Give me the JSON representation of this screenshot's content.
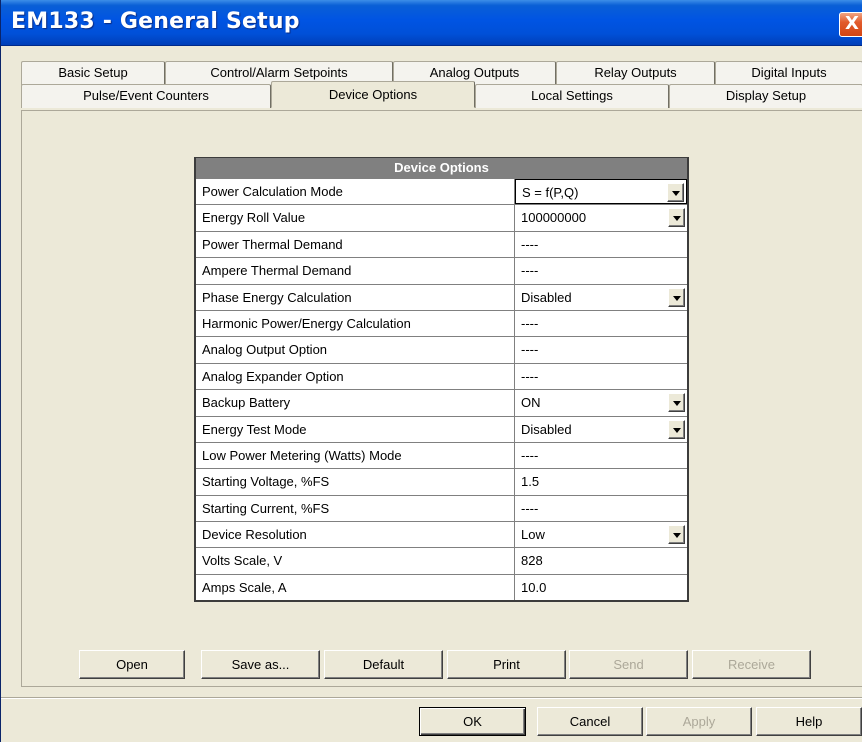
{
  "window": {
    "title": "EM133 - General Setup",
    "close_glyph": "X"
  },
  "tabs": {
    "back_row": [
      "Basic Setup",
      "Control/Alarm Setpoints",
      "Analog Outputs",
      "Relay Outputs",
      "Digital Inputs"
    ],
    "front_row": [
      "Pulse/Event Counters",
      "Device Options",
      "Local Settings",
      "Display Setup"
    ],
    "active": "Device Options"
  },
  "grid": {
    "header": "Device Options",
    "rows": [
      {
        "label": "Power Calculation Mode",
        "value": "S = f(P,Q)",
        "dropdown": true
      },
      {
        "label": "Energy Roll Value",
        "value": "100000000",
        "dropdown": true
      },
      {
        "label": "Power Thermal Demand",
        "value": "----",
        "dropdown": false
      },
      {
        "label": "Ampere Thermal Demand",
        "value": "----",
        "dropdown": false
      },
      {
        "label": "Phase Energy Calculation",
        "value": "Disabled",
        "dropdown": true
      },
      {
        "label": "Harmonic Power/Energy Calculation",
        "value": "----",
        "dropdown": false
      },
      {
        "label": "Analog Output Option",
        "value": "----",
        "dropdown": false
      },
      {
        "label": "Analog Expander Option",
        "value": "----",
        "dropdown": false
      },
      {
        "label": "Backup Battery",
        "value": "ON",
        "dropdown": true
      },
      {
        "label": "Energy Test Mode",
        "value": "Disabled",
        "dropdown": true
      },
      {
        "label": "Low Power Metering (Watts) Mode",
        "value": "----",
        "dropdown": false
      },
      {
        "label": "Starting Voltage, %FS",
        "value": "1.5",
        "dropdown": false
      },
      {
        "label": "Starting Current, %FS",
        "value": "----",
        "dropdown": false
      },
      {
        "label": "Device Resolution",
        "value": "Low",
        "dropdown": true
      },
      {
        "label": "Volts Scale, V",
        "value": "828",
        "dropdown": false
      },
      {
        "label": "Amps Scale, A",
        "value": "10.0",
        "dropdown": false
      }
    ]
  },
  "panel_buttons": {
    "open": "Open",
    "save_as": "Save as...",
    "default": "Default",
    "print": "Print",
    "send": "Send",
    "receive": "Receive"
  },
  "dialog_buttons": {
    "ok": "OK",
    "cancel": "Cancel",
    "apply": "Apply",
    "help": "Help"
  }
}
